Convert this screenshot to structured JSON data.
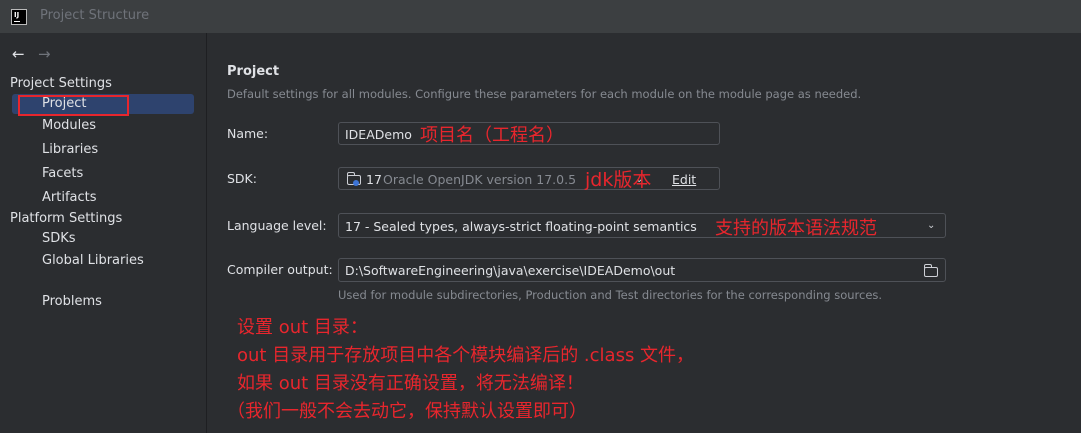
{
  "window": {
    "title": "Project Structure",
    "app_icon_text": "IJ"
  },
  "nav": {
    "back_icon": "←",
    "forward_icon": "→"
  },
  "sidebar": {
    "project_settings_label": "Project Settings",
    "platform_settings_label": "Platform Settings",
    "items": [
      {
        "label": "Project",
        "selected": true
      },
      {
        "label": "Modules"
      },
      {
        "label": "Libraries"
      },
      {
        "label": "Facets"
      },
      {
        "label": "Artifacts"
      }
    ],
    "platform_items": [
      {
        "label": "SDKs"
      },
      {
        "label": "Global Libraries"
      }
    ],
    "problems_label": "Problems"
  },
  "main": {
    "title": "Project",
    "description": "Default settings for all modules. Configure these parameters for each module on the module page as needed.",
    "name_label": "Name:",
    "name_value": "IDEADemo",
    "sdk_label": "SDK:",
    "sdk_version": "17",
    "sdk_name": "Oracle OpenJDK version 17.0.5",
    "sdk_edit_label": "Edit",
    "language_level_label": "Language level:",
    "language_level_value": "17 - Sealed types, always-strict floating-point semantics",
    "compiler_output_label": "Compiler output:",
    "compiler_output_value": "D:\\SoftwareEngineering\\java\\exercise\\IDEADemo\\out",
    "compiler_output_hint": "Used for module subdirectories, Production and Test directories for the corresponding sources."
  },
  "annotations": {
    "name_note": "项目名（工程名）",
    "sdk_note": "jdk版本",
    "language_note": "支持的版本语法规范",
    "out_line1": "设置 out 目录：",
    "out_line2": "out 目录用于存放项目中各个模块编译后的 .class 文件，",
    "out_line3": "如果 out 目录没有正确设置，将无法编译！",
    "out_line4": "（我们一般不会去动它，保持默认设置即可）"
  },
  "colors": {
    "annotation": "#e8262d",
    "selection": "#2e436e",
    "background": "#2b2d30"
  }
}
